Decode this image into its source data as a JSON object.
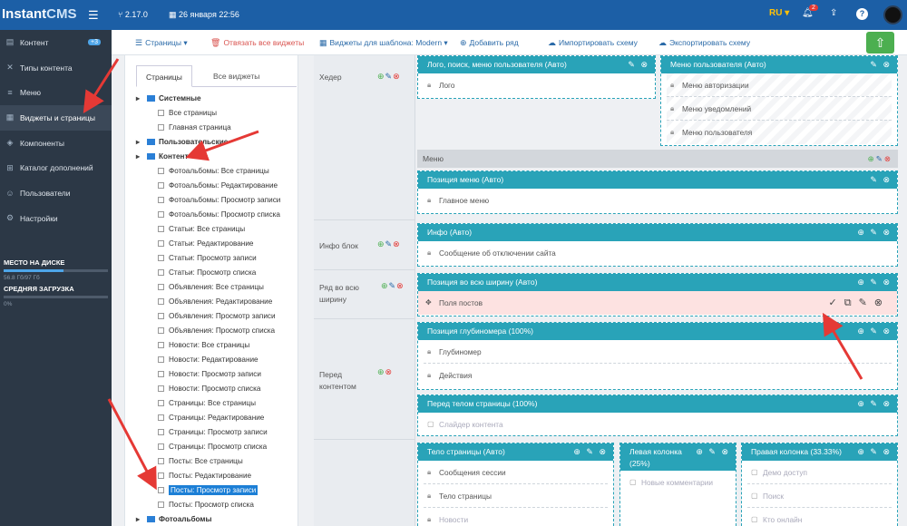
{
  "header": {
    "logo_main": "Instant",
    "logo_cms": "CMS",
    "version": "2.17.0",
    "datetime": "26 января 22:56",
    "lang": "RU",
    "notif_count": "2"
  },
  "sidebar": {
    "items": [
      {
        "label": "Контент",
        "badge": "+3"
      },
      {
        "label": "Типы контента"
      },
      {
        "label": "Меню"
      },
      {
        "label": "Виджеты и страницы"
      },
      {
        "label": "Компоненты"
      },
      {
        "label": "Каталог дополнений"
      },
      {
        "label": "Пользователи"
      },
      {
        "label": "Настройки"
      }
    ],
    "disk_title": "МЕСТО НА ДИСКЕ",
    "disk_value": "56.8 Гб/97 Гб",
    "load_title": "СРЕДНЯЯ ЗАГРУЗКА",
    "load_value": "0%"
  },
  "toolbar": {
    "pages": "Страницы",
    "unbind": "Отвязать все виджеты",
    "template_widgets": "Виджеты для шаблона: Modern",
    "add_row": "Добавить ряд",
    "import": "Импортировать схему",
    "export": "Экспортировать схему"
  },
  "tree": {
    "tab_pages": "Страницы",
    "tab_all": "Все виджеты",
    "nodes": [
      {
        "type": "folder",
        "label": "Системные"
      },
      {
        "type": "leaf",
        "label": "Все страницы"
      },
      {
        "type": "leaf",
        "label": "Главная страница"
      },
      {
        "type": "folder",
        "label": "Пользовательские"
      },
      {
        "type": "folder",
        "label": "Контент"
      },
      {
        "type": "leaf",
        "label": "Фотоальбомы: Все страницы"
      },
      {
        "type": "leaf",
        "label": "Фотоальбомы: Редактирование"
      },
      {
        "type": "leaf",
        "label": "Фотоальбомы: Просмотр записи"
      },
      {
        "type": "leaf",
        "label": "Фотоальбомы: Просмотр списка"
      },
      {
        "type": "leaf",
        "label": "Статьи: Все страницы"
      },
      {
        "type": "leaf",
        "label": "Статьи: Редактирование"
      },
      {
        "type": "leaf",
        "label": "Статьи: Просмотр записи"
      },
      {
        "type": "leaf",
        "label": "Статьи: Просмотр списка"
      },
      {
        "type": "leaf",
        "label": "Объявления: Все страницы"
      },
      {
        "type": "leaf",
        "label": "Объявления: Редактирование"
      },
      {
        "type": "leaf",
        "label": "Объявления: Просмотр записи"
      },
      {
        "type": "leaf",
        "label": "Объявления: Просмотр списка"
      },
      {
        "type": "leaf",
        "label": "Новости: Все страницы"
      },
      {
        "type": "leaf",
        "label": "Новости: Редактирование"
      },
      {
        "type": "leaf",
        "label": "Новости: Просмотр записи"
      },
      {
        "type": "leaf",
        "label": "Новости: Просмотр списка"
      },
      {
        "type": "leaf",
        "label": "Страницы: Все страницы"
      },
      {
        "type": "leaf",
        "label": "Страницы: Редактирование"
      },
      {
        "type": "leaf",
        "label": "Страницы: Просмотр записи"
      },
      {
        "type": "leaf",
        "label": "Страницы: Просмотр списка"
      },
      {
        "type": "leaf",
        "label": "Посты: Все страницы"
      },
      {
        "type": "leaf",
        "label": "Посты: Редактирование"
      },
      {
        "type": "leaf",
        "label": "Посты: Просмотр записи",
        "selected": true
      },
      {
        "type": "leaf",
        "label": "Посты: Просмотр списка"
      },
      {
        "type": "folder",
        "label": "Фотоальбомы"
      }
    ]
  },
  "layout": {
    "rows": {
      "header": "Хедер",
      "info": "Инфо блок",
      "fullwidth": "Ряд во всю ширину",
      "before_content": "Перед контентом"
    },
    "menu_row": "Меню",
    "widgets": {
      "logo_title": "Лого, поиск, меню пользователя (Авто)",
      "logo_item": "Лого",
      "usermenu_title": "Меню пользователя (Авто)",
      "usermenu_items": [
        "Меню авторизации",
        "Меню уведомлений",
        "Меню пользователя"
      ],
      "menupos_title": "Позиция меню (Авто)",
      "menupos_item": "Главное меню",
      "info_title": "Инфо (Авто)",
      "info_item": "Сообщение об отключении сайта",
      "full_title": "Позиция во всю ширину (Авто)",
      "full_item": "Поля постов",
      "depth_title": "Позиция глубиномера (100%)",
      "depth_items": [
        "Глубиномер",
        "Действия"
      ],
      "before_body_title": "Перед телом страницы (100%)",
      "before_body_item": "Слайдер контента",
      "body_title": "Тело страницы (Авто)",
      "body_items": [
        "Сообщения сессии",
        "Тело страницы",
        "Новости"
      ],
      "left_title": "Левая колонка (25%)",
      "left_item": "Новые комментарии",
      "right_title": "Правая колонка (33.33%)",
      "right_items": [
        "Демо доступ",
        "Поиск",
        "Кто онлайн"
      ]
    }
  },
  "colors": {
    "topbar": "#1c5fa6",
    "sidebar": "#2c3846",
    "widget_header": "#29a3b8",
    "highlight_row": "#fde2e1",
    "annotation_arrow": "#e53935"
  }
}
